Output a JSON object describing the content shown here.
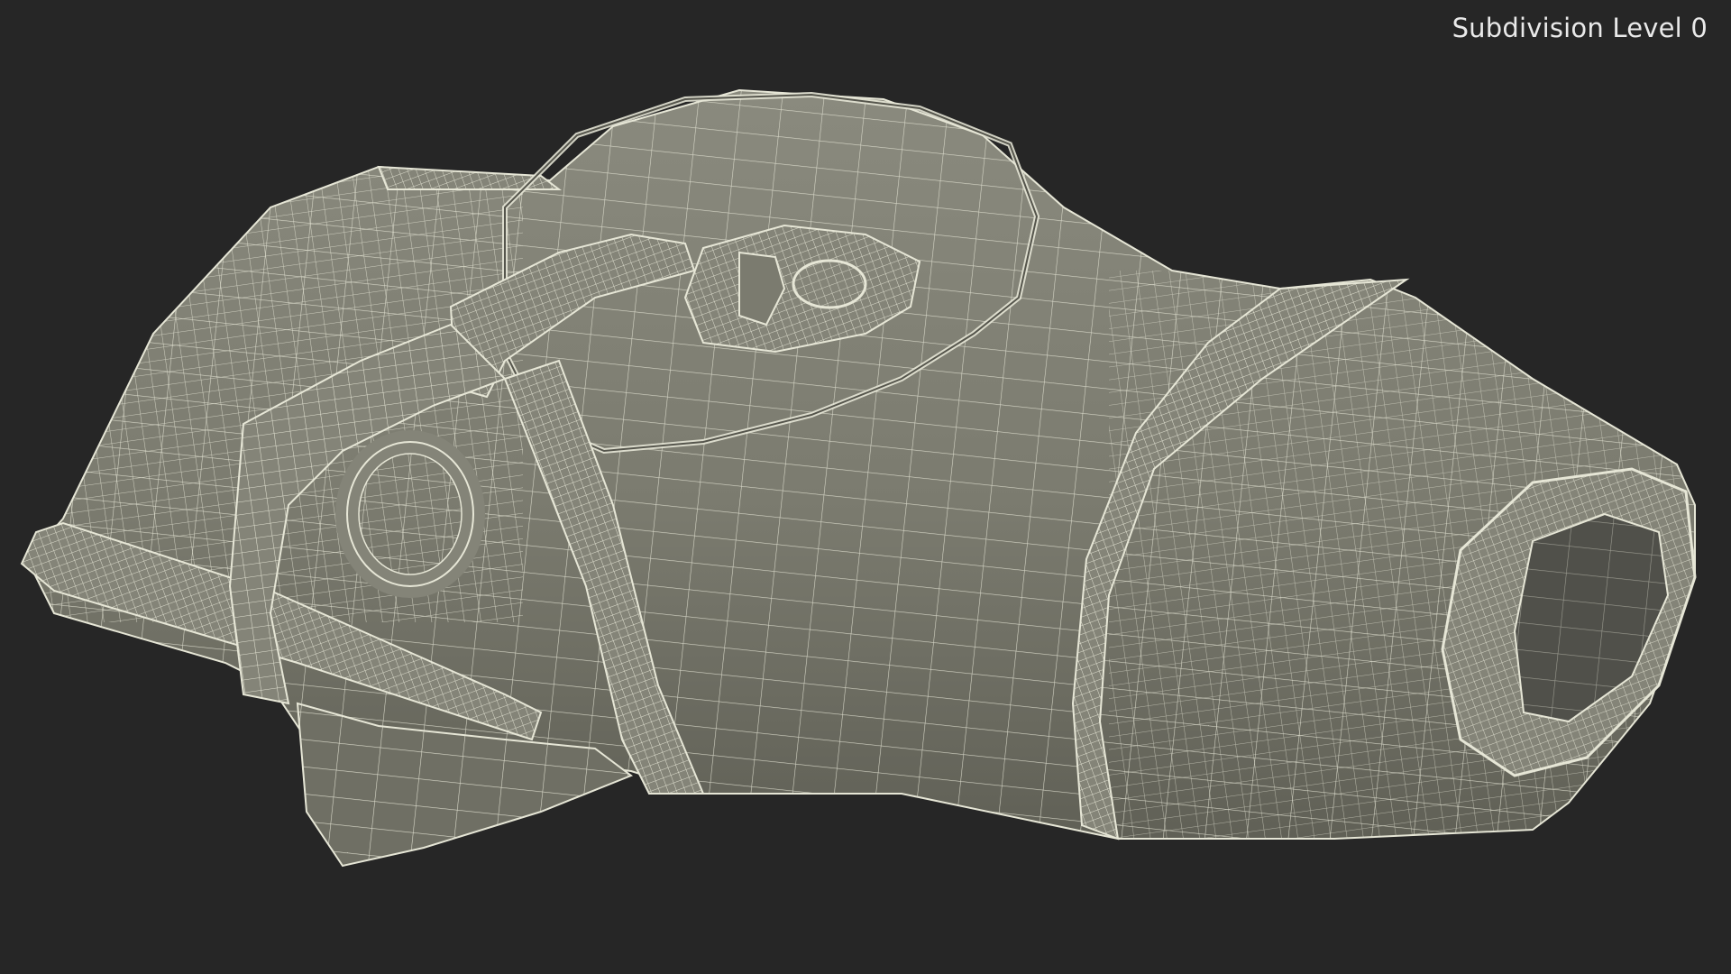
{
  "viewport": {
    "label": "Subdivision Level 0",
    "background_color": "#262626",
    "mesh_fill_color": "#7b7b6f",
    "mesh_shadow_color": "#55554c",
    "wire_color": "#e6e6d6"
  }
}
